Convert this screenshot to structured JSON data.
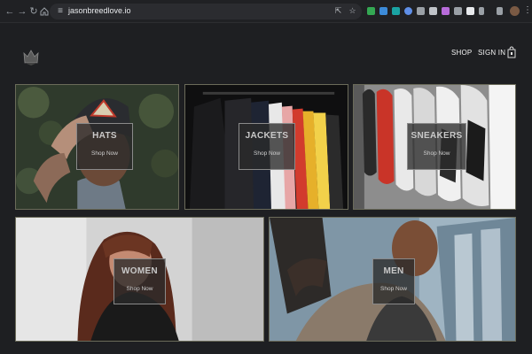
{
  "browser": {
    "url": "jasonbreedlove.io",
    "nav": [
      "back-icon",
      "forward-icon",
      "reload-icon",
      "home-icon"
    ],
    "address_icons": [
      "share-icon",
      "bookmark-star-icon"
    ],
    "extensions": [
      "#34a853",
      "#3c8bd9",
      "#1aa3a3",
      "#5f8fe8",
      "#9aa0a6",
      "#c0c4c9",
      "#b76bd9",
      "#9aa0a6",
      "#e8eaed",
      "#9aa0a6"
    ]
  },
  "site": {
    "nav": {
      "shop": "SHOP",
      "sign_in": "SIGN IN"
    }
  },
  "categories": [
    {
      "title": "HATS",
      "cta": "Shop Now"
    },
    {
      "title": "JACKETS",
      "cta": "Shop Now"
    },
    {
      "title": "SNEAKERS",
      "cta": "Shop Now"
    },
    {
      "title": "WOMEN",
      "cta": "Shop Now"
    },
    {
      "title": "MEN",
      "cta": "Shop Now"
    }
  ],
  "colors": {
    "page_bg": "#1e1f22",
    "overlay_bg": "#2a2a2a",
    "tile_border": "#6b6b5a"
  }
}
